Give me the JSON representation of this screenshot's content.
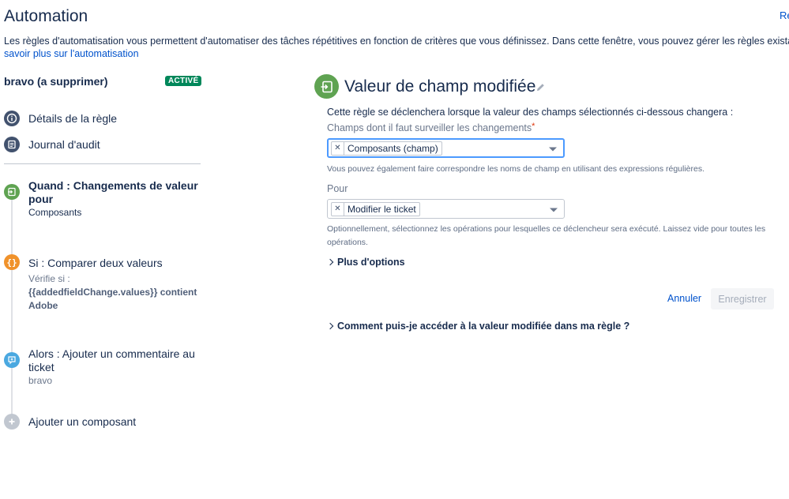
{
  "page": {
    "title": "Automation",
    "top_right_link": "Re",
    "intro": "Les règles d'automatisation vous permettent d'automatiser des tâches répétitives en fonction de critères que vous définissez. Dans cette fenêtre, vous pouvez gérer les règles existantes et",
    "intro_link": "savoir plus sur l'automatisation"
  },
  "sidebar": {
    "rule_name": "bravo (a supprimer)",
    "status": "ACTIVÉ",
    "nav": [
      {
        "label": "Détails de la règle",
        "icon": "info-icon"
      },
      {
        "label": "Journal d'audit",
        "icon": "audit-log-icon"
      }
    ],
    "steps": [
      {
        "title": "Quand : Changements de valeur pour",
        "sub": "Composants",
        "icon": "field-change-icon",
        "color": "#5fa352"
      },
      {
        "title": "Si : Comparer deux valeurs",
        "detail_label": "Vérifie si :",
        "detail_code": "{{addedfieldChange.values}} contient Adobe",
        "icon": "condition-icon",
        "color": "#f0922b"
      },
      {
        "title": "Alors : Ajouter un commentaire au ticket",
        "sub": "bravo",
        "icon": "comment-icon",
        "color": "#4aa8e0"
      },
      {
        "title": "Ajouter un composant",
        "icon": "add-icon",
        "color": "#c1c7d0"
      }
    ]
  },
  "main": {
    "title": "Valeur de champ modifiée",
    "description": "Cette règle se déclenchera lorsque la valeur des champs sélectionnés ci-dessous changera :",
    "fields_label": "Champs dont il faut surveiller les changements",
    "required_mark": "*",
    "fields_value": "Composants (champ)",
    "fields_help": "Vous pouvez également faire correspondre les noms de champ en utilisant des expressions régulières.",
    "for_label": "Pour",
    "for_value": "Modifier le ticket",
    "for_help": "Optionnellement, sélectionnez les opérations pour lesquelles ce déclencheur sera exécuté. Laissez vide pour toutes les opérations.",
    "more_options": "Plus d'options",
    "cancel": "Annuler",
    "save": "Enregistrer",
    "faq": "Comment puis-je accéder à la valeur modifiée dans ma règle ?"
  },
  "colors": {
    "accent": "#0052cc",
    "active": "#00875a",
    "trigger": "#5fa352",
    "condition": "#f0922b",
    "action": "#4aa8e0"
  }
}
